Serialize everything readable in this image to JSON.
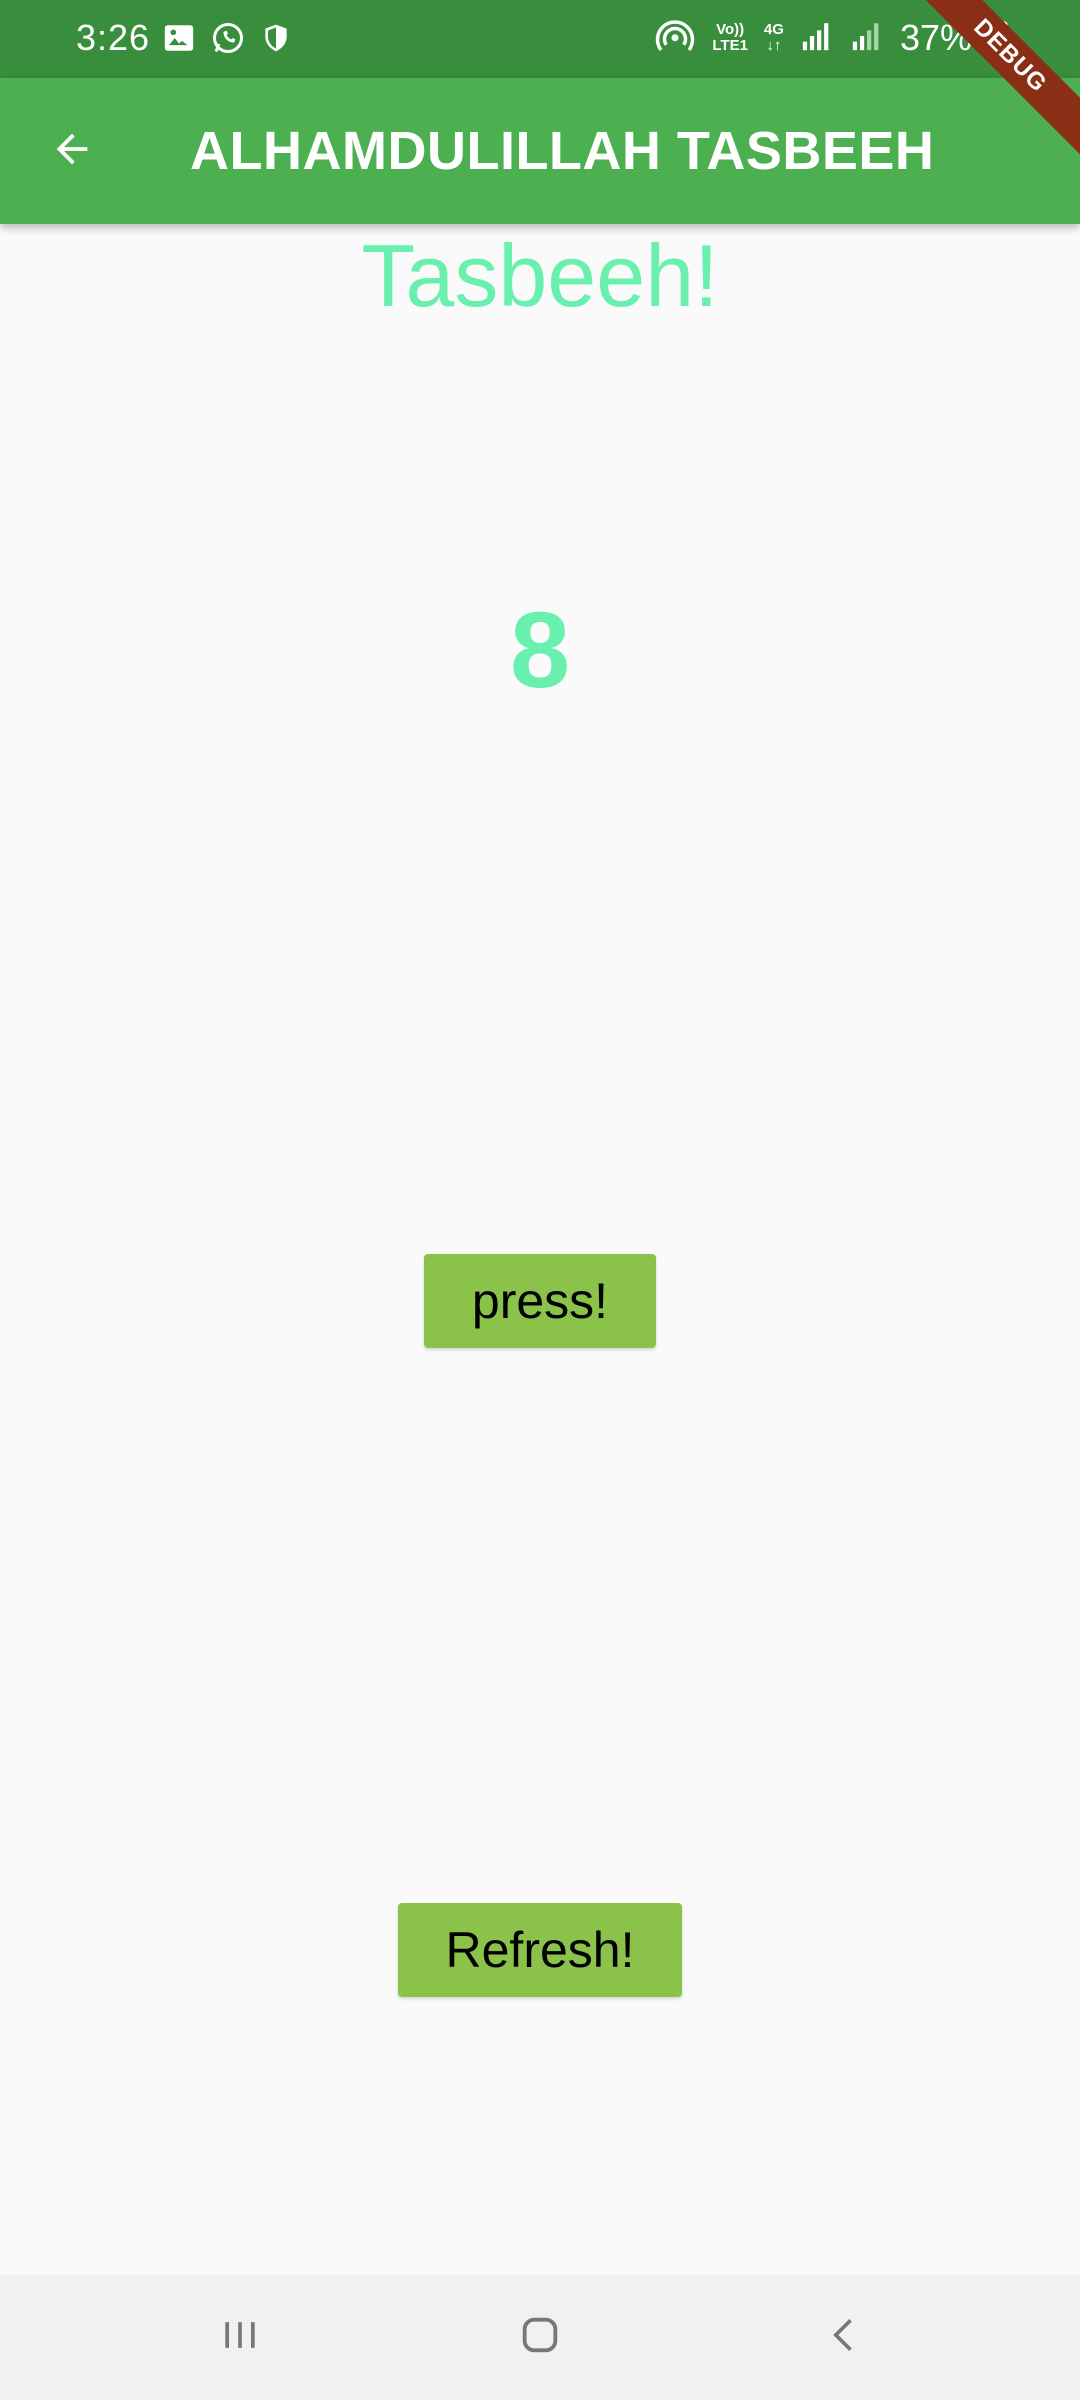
{
  "status_bar": {
    "time": "3:26",
    "battery": "37%",
    "network_top": "Vo))",
    "network_bottom": "LTE1",
    "data_top": "4G",
    "icons": [
      "image-icon",
      "whatsapp-icon",
      "shield-icon",
      "hotspot-icon",
      "signal-icon",
      "signal-icon",
      "battery-icon"
    ]
  },
  "app_bar": {
    "title": "ALHAMDULILLAH TASBEEH",
    "back_icon": "arrow-left-icon"
  },
  "debug_banner": "DEBUG",
  "main": {
    "heading": "Tasbeeh!",
    "count": "8",
    "press_label": "press!",
    "refresh_label": "Refresh!"
  },
  "nav_bar": {
    "icons": [
      "recents-icon",
      "home-icon",
      "back-icon"
    ]
  },
  "colors": {
    "status_bar": "#388e3c",
    "app_bar": "#4caf50",
    "accent": "#69f0ae",
    "button": "#8bc34a",
    "background": "#fafafa"
  }
}
